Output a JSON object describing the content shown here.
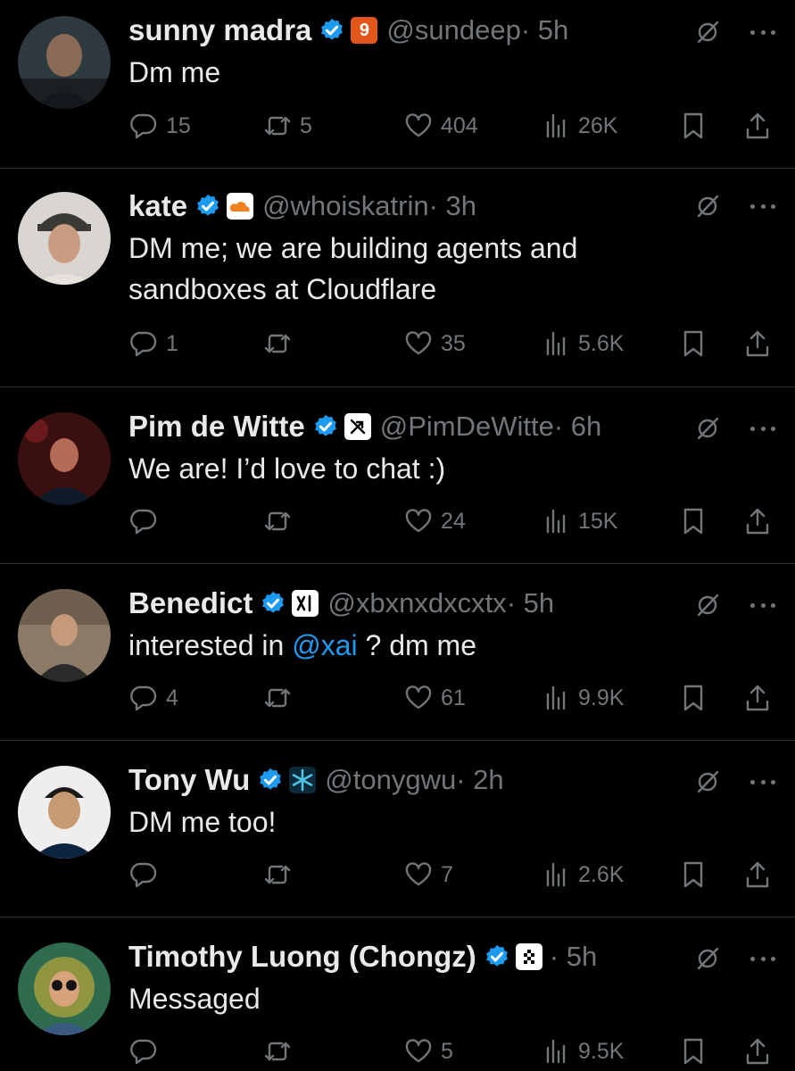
{
  "tweets": [
    {
      "name": "sunny madra",
      "handle": "@sundeep",
      "time": "· 5h",
      "text": "Dm me",
      "affiliate": {
        "icon": "number-nine-badge",
        "label": "9",
        "bg": "#e2561c",
        "fg": "#ffffff"
      },
      "avatar_colors": [
        "#2e3a3f",
        "#8a6a55",
        "#1c1f22"
      ],
      "counts": {
        "replies": "15",
        "reposts": "5",
        "likes": "404",
        "views": "26K"
      }
    },
    {
      "name": "kate",
      "handle": "@whoiskatrin",
      "time": "· 3h",
      "text": "DM me; we are building agents and sandboxes at Cloudflare",
      "affiliate": {
        "icon": "cloudflare-icon",
        "label": "",
        "bg": "#ffffff",
        "fg": "#f38020"
      },
      "avatar_colors": [
        "#d9d6d2",
        "#c99d82",
        "#3a3a35"
      ],
      "counts": {
        "replies": "1",
        "reposts": "",
        "likes": "35",
        "views": "5.6K"
      }
    },
    {
      "name": "Pim de Witte",
      "handle": "@PimDeWitte",
      "time": "· 6h",
      "text": "We are! I’d love to chat :)",
      "affiliate": {
        "icon": "compass-arrow-icon",
        "label": "",
        "bg": "#ffffff",
        "fg": "#000000"
      },
      "avatar_colors": [
        "#3a0f10",
        "#b36b55",
        "#0e1a2a"
      ],
      "counts": {
        "replies": "",
        "reposts": "",
        "likes": "24",
        "views": "15K"
      }
    },
    {
      "name": "Benedict",
      "handle": "@xbxnxdxcxtx",
      "time": "· 5h",
      "text_before": "interested in ",
      "mention": "@xai",
      "text_after": " ? dm me",
      "affiliate": {
        "icon": "xai-logo-icon",
        "label": "",
        "bg": "#ffffff",
        "fg": "#000000"
      },
      "avatar_colors": [
        "#8c7a66",
        "#c49a7a",
        "#2b2b2b"
      ],
      "counts": {
        "replies": "4",
        "reposts": "",
        "likes": "61",
        "views": "9.9K"
      }
    },
    {
      "name": "Tony Wu",
      "handle": "@tonygwu",
      "time": "· 2h",
      "text": "DM me too!",
      "affiliate": {
        "icon": "snowflake-logo-icon",
        "label": "",
        "bg": "#0c2b3a",
        "fg": "#4fc3e8"
      },
      "avatar_colors": [
        "#eeeeee",
        "#c79a72",
        "#0d2440"
      ],
      "counts": {
        "replies": "",
        "reposts": "",
        "likes": "7",
        "views": "2.6K"
      }
    },
    {
      "name": "Timothy Luong (Chongz)",
      "handle": "",
      "time": "· 5h",
      "text": "Messaged",
      "affiliate": {
        "icon": "pixel-diamond-icon",
        "label": "",
        "bg": "#ffffff",
        "fg": "#000000"
      },
      "avatar_colors": [
        "#2f6b4f",
        "#d8a27a",
        "#f2c230"
      ],
      "counts": {
        "replies": "",
        "reposts": "",
        "likes": "5",
        "views": "9.5K"
      }
    }
  ],
  "icons": {
    "verified": "verified-badge-icon",
    "grok": "grok-icon",
    "more": "more-dots-icon",
    "reply": "reply-icon",
    "repost": "repost-icon",
    "like": "heart-icon",
    "views": "views-chart-icon",
    "bookmark": "bookmark-icon",
    "share": "share-icon"
  },
  "colors": {
    "background": "#000000",
    "text": "#e7e9ea",
    "secondary": "#71767b",
    "accent": "#1d9bf0",
    "divider": "#2f3336"
  }
}
